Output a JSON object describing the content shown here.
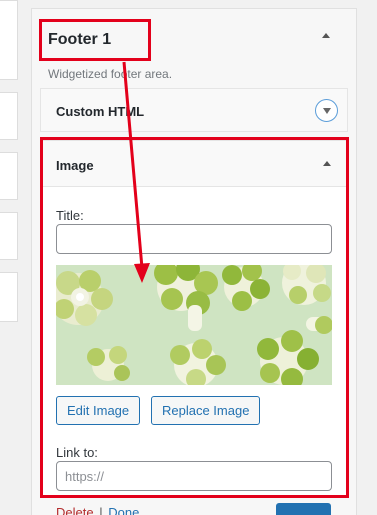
{
  "sidebar": {
    "title": "Footer 1",
    "description": "Widgetized footer area."
  },
  "widgets": {
    "custom_html": {
      "title": "Custom HTML"
    },
    "image": {
      "title": "Image",
      "title_field_label": "Title:",
      "title_field_value": "",
      "edit_button": "Edit Image",
      "replace_button": "Replace Image",
      "link_label": "Link to:",
      "link_placeholder": "https://"
    }
  },
  "actions": {
    "delete": "Delete",
    "separator": "|",
    "done": "Done"
  },
  "colors": {
    "annotation": "#e3001b",
    "accent": "#2271b1",
    "delete": "#b32d2e"
  },
  "icons": {
    "sidebar_toggle": "caret-up-icon",
    "custom_html_toggle": "circle-chevron-down-icon",
    "image_toggle": "caret-up-icon"
  }
}
